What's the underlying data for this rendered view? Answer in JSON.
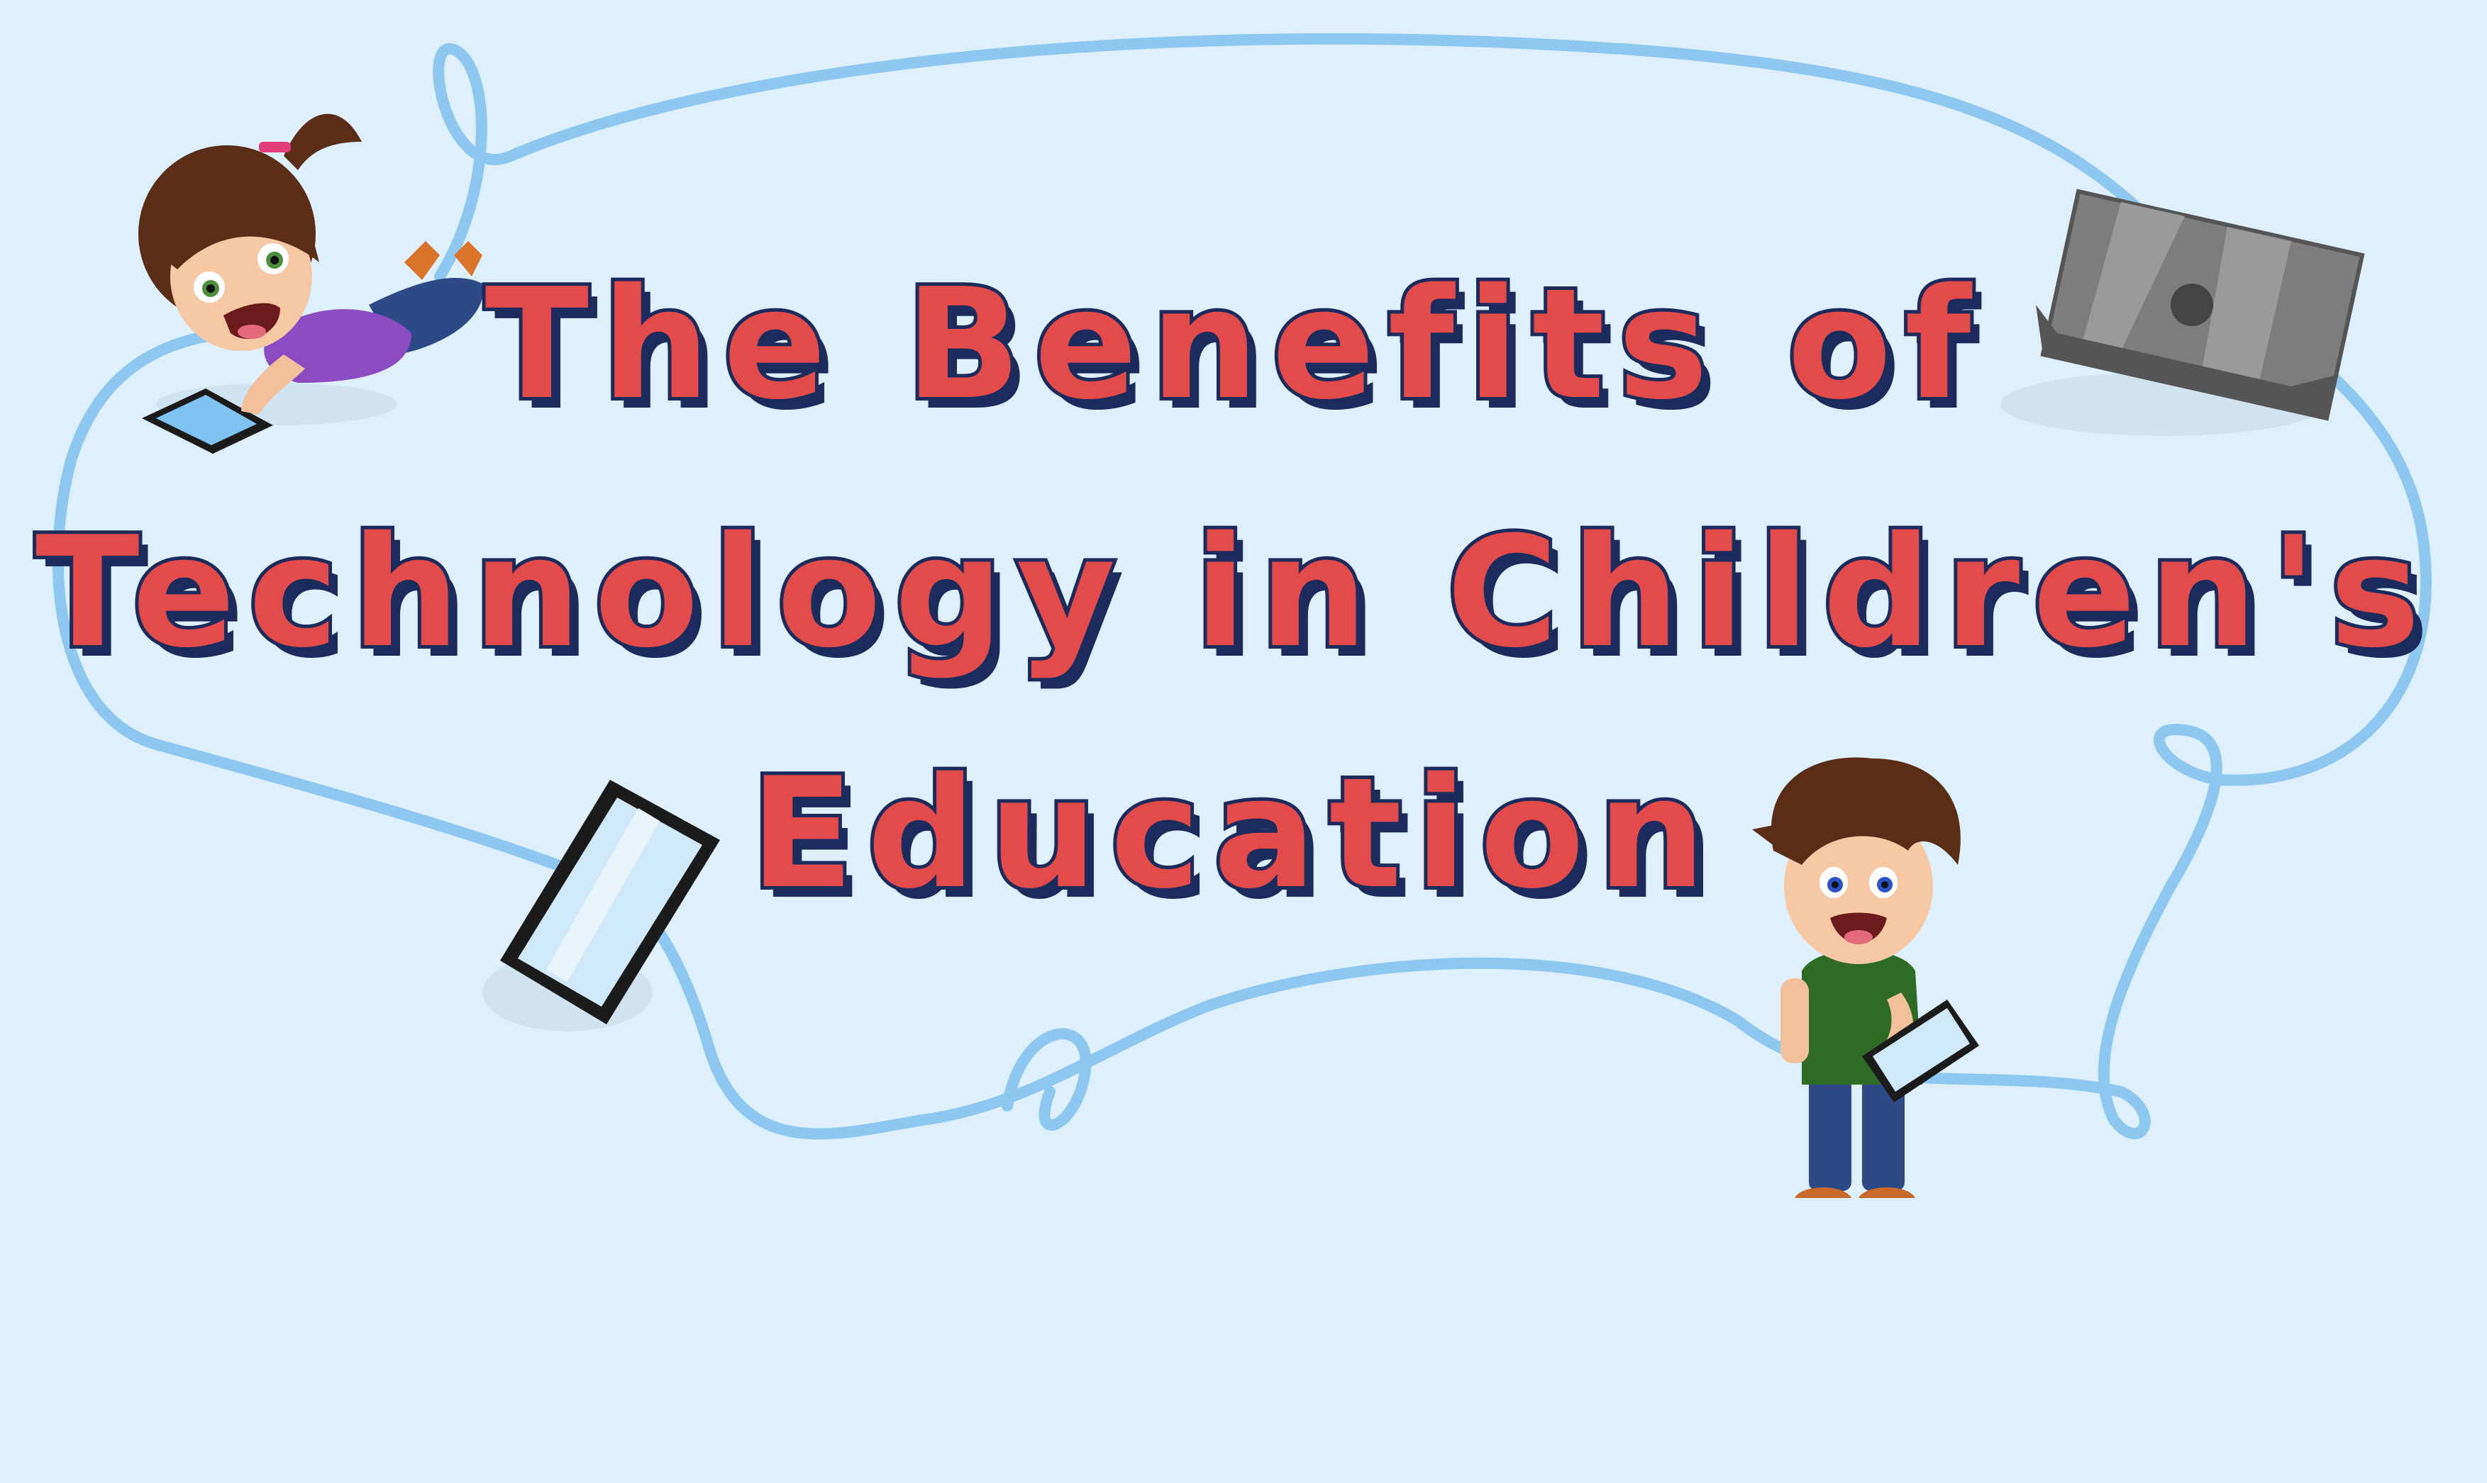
{
  "title": {
    "line1": "The Benefits of",
    "line2": "Technology in Children's",
    "line3": "Education"
  },
  "colors": {
    "background": "#def0fd",
    "title_fill": "#e34b4b",
    "title_outline": "#1a2b5c",
    "ribbon": "#8ec8f0"
  },
  "illustrations": {
    "girl": "girl-with-tablet",
    "boy": "boy-with-tablet",
    "laptop": "laptop-icon",
    "tablet": "tablet-icon"
  }
}
